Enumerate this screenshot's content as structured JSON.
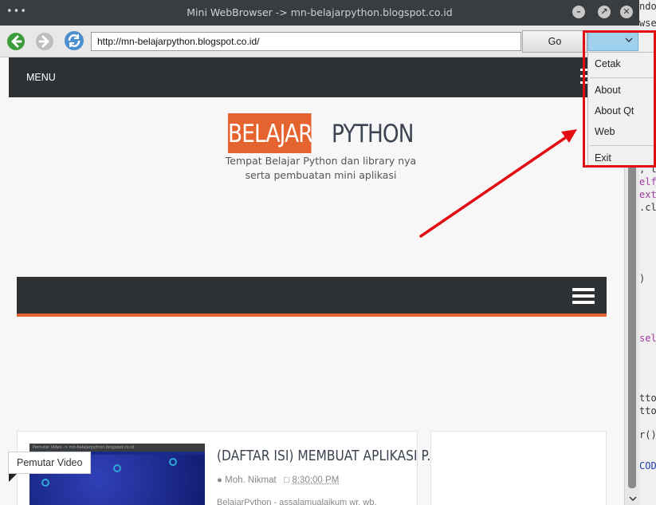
{
  "window": {
    "title": "Mini WebBrowser -> mn-belajarpython.blogspot.co.id",
    "dots": "•••"
  },
  "toolbar": {
    "url_value": "http://mn-belajarpython.blogspot.co.id/",
    "go_label": "Go"
  },
  "dropdown_menu": {
    "items": [
      "Cetak",
      "About",
      "About Qt",
      "Web",
      "Exit"
    ]
  },
  "page": {
    "menu_label": "MENU",
    "logo_part1": "BELAJAR",
    "logo_part2": "PYTHON",
    "tagline_line1": "Tempat Belajar Python dan library nya",
    "tagline_line2": "serta pembuatan mini aplikasi",
    "post": {
      "title": "(DAFTAR ISI) MEMBUAT APLIKASI P...",
      "author": "Moh. Nikmat",
      "time": "8:30:00 PM",
      "excerpt": "BelajarPython - assalamualaikum wr. wb.",
      "thumb_caption": "Pemutar Video -> mn-belajarpython.blogspot.co.id"
    },
    "tooltip": "Pemutar Video"
  },
  "background_code": {
    "lines": [
      "ndow",
      "wse",
      "",
      "",
      ", t",
      "elf.",
      "ext",
      ".cl",
      "",
      ")",
      "",
      "self",
      "",
      "",
      "tton",
      "tton",
      "",
      "r()",
      "",
      "CODE"
    ]
  },
  "colors": {
    "accent_orange": "#e4632f",
    "dark_band": "#2e3134",
    "highlight_red": "#e20d13"
  }
}
